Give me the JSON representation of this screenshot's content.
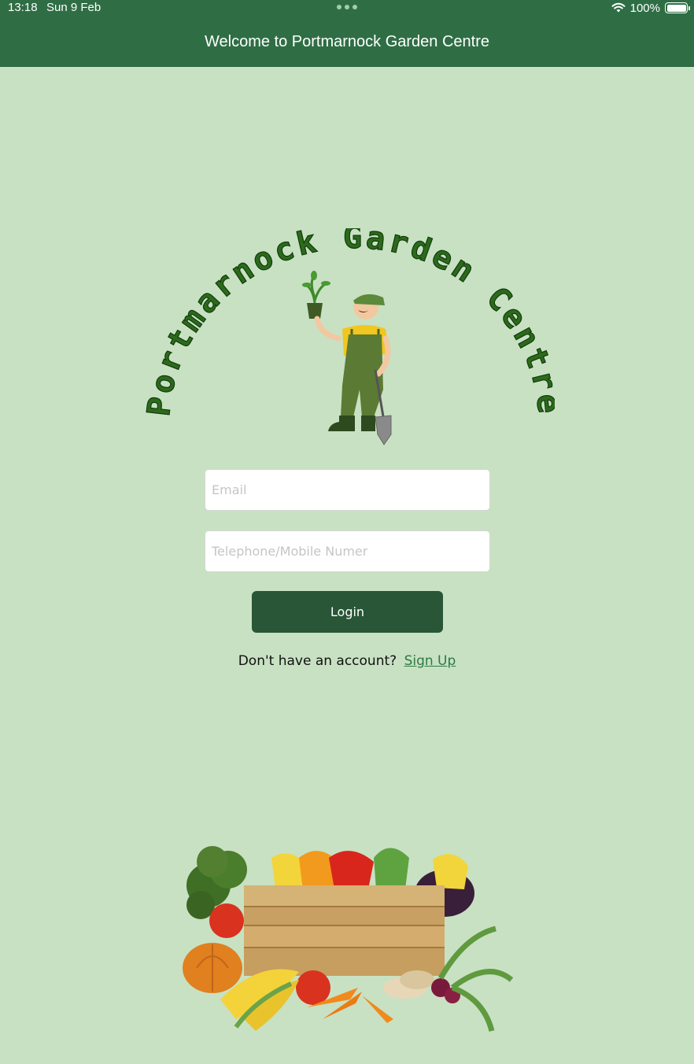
{
  "status_bar": {
    "time": "13:18",
    "date": "Sun 9 Feb",
    "battery": "100%"
  },
  "header": {
    "title": "Welcome to Portmarnock Garden Centre"
  },
  "logo": {
    "arc_text": "Portmarnock Garden Centre"
  },
  "form": {
    "email_placeholder": "Email",
    "phone_placeholder": "Telephone/Mobile Numer",
    "login_label": "Login",
    "signup_prompt": "Don't have an account?",
    "signup_link": "Sign Up"
  },
  "colors": {
    "background": "#c8e1c3",
    "header": "#2f6e45",
    "button": "#285637",
    "link": "#2e7a44"
  }
}
